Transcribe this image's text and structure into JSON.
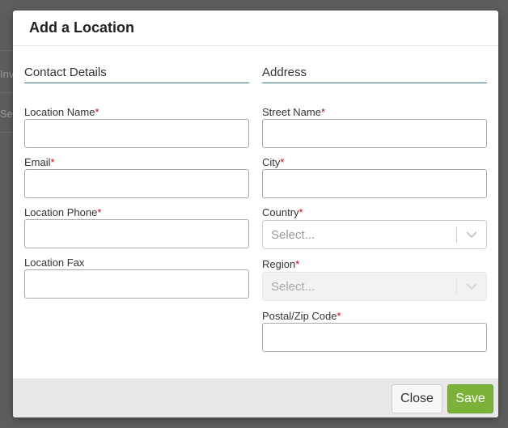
{
  "backdrop": {
    "fragment_1": "Invento",
    "fragment_2": "Search"
  },
  "modal": {
    "title": "Add a Location",
    "contact": {
      "section_title": "Contact Details",
      "location_name_label": "Location Name",
      "email_label": "Email",
      "location_phone_label": "Location Phone",
      "location_fax_label": "Location Fax"
    },
    "address": {
      "section_title": "Address",
      "street_name_label": "Street Name",
      "city_label": "City",
      "country_label": "Country",
      "country_placeholder": "Select...",
      "region_label": "Region",
      "region_placeholder": "Select...",
      "postal_label": "Postal/Zip Code"
    },
    "required_marker": "*",
    "footer": {
      "close_label": "Close",
      "save_label": "Save"
    }
  },
  "colors": {
    "accent_underline": "#3a7a99",
    "required": "#d0021b",
    "save_button": "#7cb23a"
  },
  "icons": {
    "dropdown": "chevron-down-icon"
  }
}
